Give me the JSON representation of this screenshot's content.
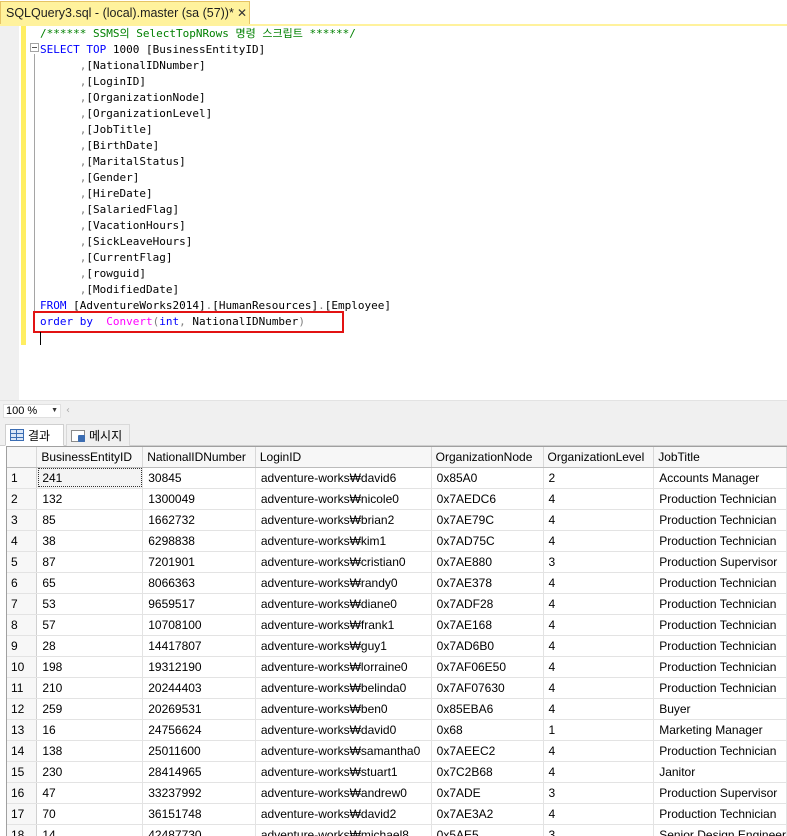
{
  "tab": {
    "title": "SQLQuery3.sql - (local).master (sa (57))*",
    "close_glyph": "✕"
  },
  "editor": {
    "comment": "/****** SSMS의 SelectTopNRows 명령 스크립트 ******/",
    "select_kw": "SELECT",
    "top_kw": "TOP",
    "top_rest": " 1000 [BusinessEntityID]",
    "columns": [
      "[NationalIDNumber]",
      "[LoginID]",
      "[OrganizationNode]",
      "[OrganizationLevel]",
      "[JobTitle]",
      "[BirthDate]",
      "[MaritalStatus]",
      "[Gender]",
      "[HireDate]",
      "[SalariedFlag]",
      "[VacationHours]",
      "[SickLeaveHours]",
      "[CurrentFlag]",
      "[rowguid]",
      "[ModifiedDate]"
    ],
    "from_kw": "FROM",
    "from_db": "[AdventureWorks2014]",
    "from_schema": "[HumanResources]",
    "from_table": "[Employee]",
    "order_kw": "order by",
    "convert_fn": "Convert",
    "int_kw": "int",
    "order_arg": "NationalIDNumber"
  },
  "zoom": {
    "value": "100 %",
    "arrow": "▼",
    "scroll_left": "‹"
  },
  "result_tabs": {
    "results": "결과",
    "messages": "메시지"
  },
  "grid": {
    "columns": [
      "BusinessEntityID",
      "NationalIDNumber",
      "LoginID",
      "OrganizationNode",
      "OrganizationLevel",
      "JobTitle"
    ],
    "rows": [
      [
        "1",
        "241",
        "30845",
        "adventure-works₩david6",
        "0x85A0",
        "2",
        "Accounts Manager"
      ],
      [
        "2",
        "132",
        "1300049",
        "adventure-works₩nicole0",
        "0x7AEDC6",
        "4",
        "Production Technician"
      ],
      [
        "3",
        "85",
        "1662732",
        "adventure-works₩brian2",
        "0x7AE79C",
        "4",
        "Production Technician"
      ],
      [
        "4",
        "38",
        "6298838",
        "adventure-works₩kim1",
        "0x7AD75C",
        "4",
        "Production Technician"
      ],
      [
        "5",
        "87",
        "7201901",
        "adventure-works₩cristian0",
        "0x7AE880",
        "3",
        "Production Supervisor"
      ],
      [
        "6",
        "65",
        "8066363",
        "adventure-works₩randy0",
        "0x7AE378",
        "4",
        "Production Technician"
      ],
      [
        "7",
        "53",
        "9659517",
        "adventure-works₩diane0",
        "0x7ADF28",
        "4",
        "Production Technician"
      ],
      [
        "8",
        "57",
        "10708100",
        "adventure-works₩frank1",
        "0x7AE168",
        "4",
        "Production Technician"
      ],
      [
        "9",
        "28",
        "14417807",
        "adventure-works₩guy1",
        "0x7AD6B0",
        "4",
        "Production Technician"
      ],
      [
        "10",
        "198",
        "19312190",
        "adventure-works₩lorraine0",
        "0x7AF06E50",
        "4",
        "Production Technician"
      ],
      [
        "11",
        "210",
        "20244403",
        "adventure-works₩belinda0",
        "0x7AF07630",
        "4",
        "Production Technician"
      ],
      [
        "12",
        "259",
        "20269531",
        "adventure-works₩ben0",
        "0x85EBA6",
        "4",
        "Buyer"
      ],
      [
        "13",
        "16",
        "24756624",
        "adventure-works₩david0",
        "0x68",
        "1",
        "Marketing Manager"
      ],
      [
        "14",
        "138",
        "25011600",
        "adventure-works₩samantha0",
        "0x7AEEC2",
        "4",
        "Production Technician"
      ],
      [
        "15",
        "230",
        "28414965",
        "adventure-works₩stuart1",
        "0x7C2B68",
        "4",
        "Janitor"
      ],
      [
        "16",
        "47",
        "33237992",
        "adventure-works₩andrew0",
        "0x7ADE",
        "3",
        "Production Supervisor"
      ],
      [
        "17",
        "70",
        "36151748",
        "adventure-works₩david2",
        "0x7AE3A2",
        "4",
        "Production Technician"
      ],
      [
        "18",
        "14",
        "42487730",
        "adventure-works₩michael8",
        "0x5AE5",
        "3",
        "Senior Design Engineer"
      ]
    ]
  }
}
